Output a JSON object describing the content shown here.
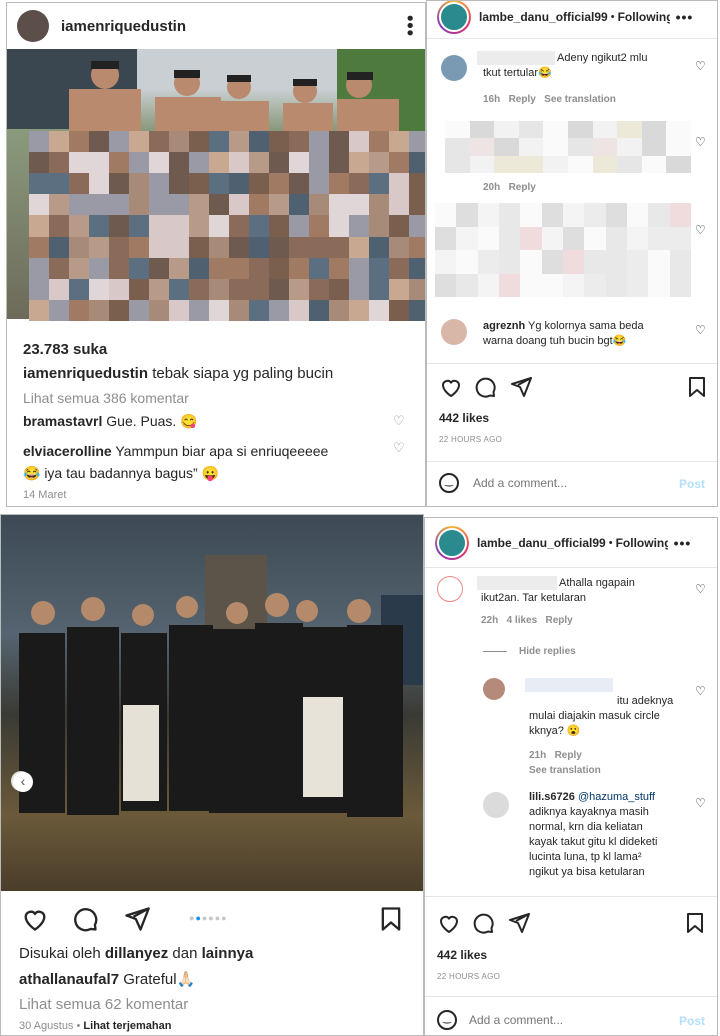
{
  "top": {
    "left": {
      "username": "iamenriquedustin",
      "likes": "23.783 suka",
      "caption_user": "iamenriquedustin",
      "caption_text": "tebak siapa yg paling bucin",
      "view_comments": "Lihat semua 386 komentar",
      "comments": [
        {
          "user": "bramastavrl",
          "text": "Gue. Puas. 😋"
        },
        {
          "user": "elviacerolline",
          "text": "Yammpun biar apa si enriuqeeeee",
          "text2": "😂 iya tau badannya bagus” 😛"
        }
      ],
      "date": "14 Maret"
    },
    "right": {
      "username": "lambe_danu_official99",
      "dot": "•",
      "follow": "Following",
      "c1_text": "Adeny ngikut2 mlu",
      "c1_text2": "tkut tertular😂",
      "c1_time": "16h",
      "c1_reply": "Reply",
      "c1_translate": "See translation",
      "c2_time": "20h",
      "c2_reply": "Reply",
      "c3_user": "agreznh",
      "c3_text": "Yg kolornya sama beda",
      "c3_text2": "warna doang tuh bucin bgt😂",
      "likes": "442 likes",
      "ago": "22 HOURS AGO",
      "add_comment": "Add a comment...",
      "post": "Post"
    }
  },
  "bottom": {
    "left": {
      "liked_prefix": "Disukai oleh ",
      "liked_user": "dillanyez",
      "liked_mid": " dan ",
      "liked_others": "lainnya",
      "caption_user": "athallanaufal7",
      "caption_text": "Grateful🙏🏻",
      "view_comments": "Lihat semua 62 komentar",
      "date": "30 Agustus",
      "dot": "•",
      "translate": "Lihat terjemahan"
    },
    "right": {
      "username": "lambe_danu_official99",
      "dot": "•",
      "follow": "Following",
      "c1_text": "Athalla ngapain",
      "c1_text2": "ikut2an. Tar ketularan",
      "c1_time": "22h",
      "c1_likes": "4 likes",
      "c1_reply": "Reply",
      "hide_replies": "Hide replies",
      "r1_text": "itu adeknya",
      "r1_text2": "mulai diajakin masuk circle",
      "r1_text3": "kknya? 😮",
      "r1_time": "21h",
      "r1_reply": "Reply",
      "r1_translate": "See translation",
      "r2_user": "lili.s6726",
      "r2_mention": "@hazuma_stuff",
      "r2_lines": [
        "adiknya kayaknya masih",
        "normal, krn dia keliatan",
        "kayak takut gitu kl dideketi",
        "lucinta luna, tp kl lama²",
        "ngikut ya bisa ketularan"
      ],
      "likes": "442 likes",
      "ago": "22 HOURS AGO",
      "add_comment": "Add a comment...",
      "post": "Post"
    }
  }
}
